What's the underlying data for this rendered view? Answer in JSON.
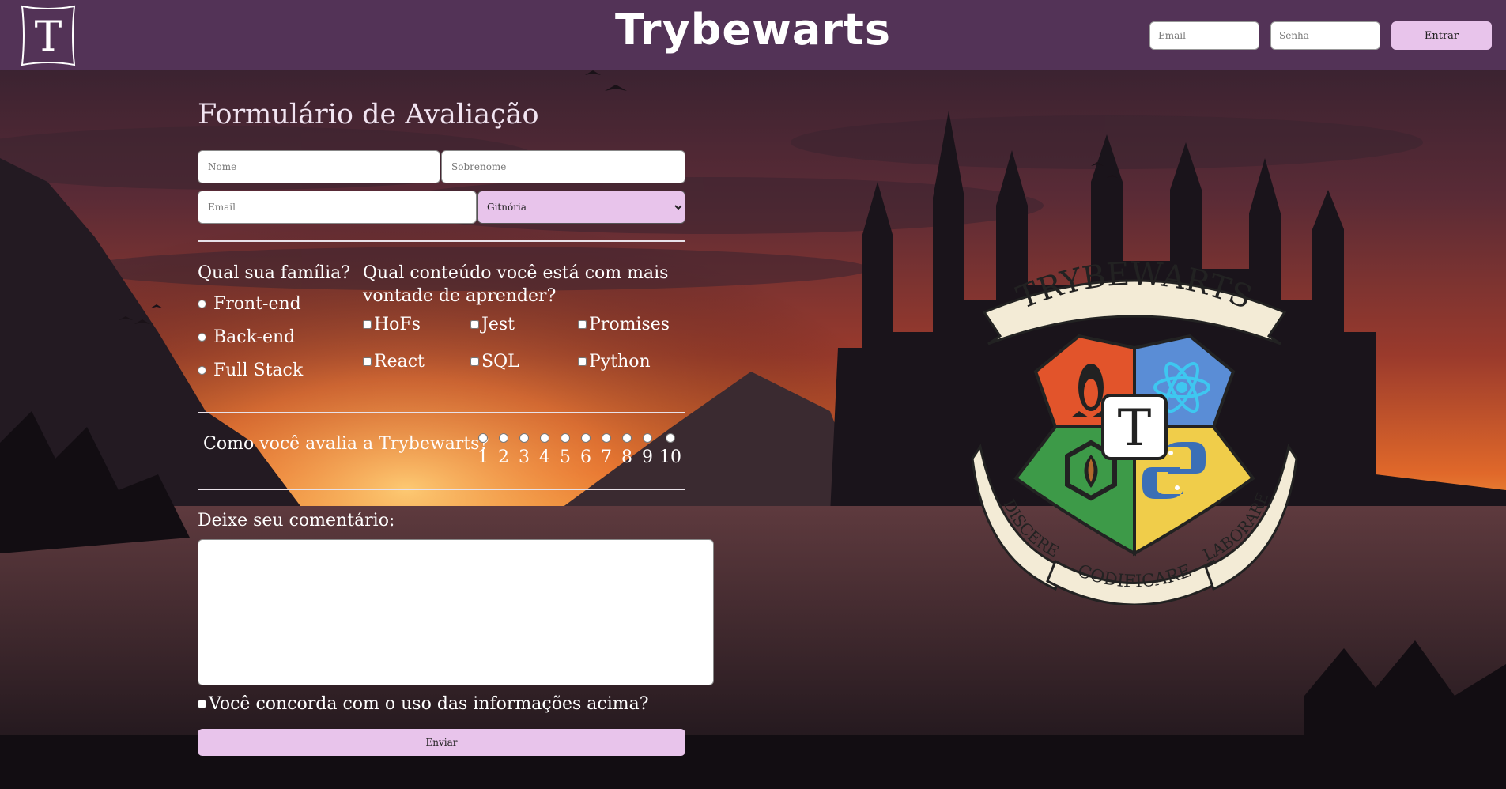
{
  "header": {
    "logo_letter": "T",
    "site_title": "Trybewarts",
    "email_placeholder": "Email",
    "password_placeholder": "Senha",
    "login_label": "Entrar"
  },
  "form": {
    "title": "Formulário de Avaliação",
    "name_placeholder": "Nome",
    "lastname_placeholder": "Sobrenome",
    "email_placeholder": "Email",
    "house_selected": "Gitnória",
    "family_question": "Qual sua família?",
    "family_options": [
      "Front-end",
      "Back-end",
      "Full Stack"
    ],
    "content_question_line1": "Qual conteúdo você está com mais",
    "content_question_line2": "vontade de aprender?",
    "content_options": [
      "HoFs",
      "Jest",
      "Promises",
      "React",
      "SQL",
      "Python"
    ],
    "rating_question": "Como você avalia a Trybewarts?",
    "rating_options": [
      "1",
      "2",
      "3",
      "4",
      "5",
      "6",
      "7",
      "8",
      "9",
      "10"
    ],
    "comment_label": "Deixe seu comentário:",
    "agreement_label": "Você concorda com o uso das informações acima?",
    "submit_label": "Enviar"
  },
  "crest": {
    "banner_text": "TRYBEWARTS",
    "center_letter": "T",
    "motto_left": "DISCERE",
    "motto_middle": "CODIFICARE",
    "motto_right": "LABORARE"
  },
  "colors": {
    "header_bg": "#533357",
    "accent_button": "#e8c4eb",
    "crest_red": "#e2542b",
    "crest_blue": "#5a8dd6",
    "crest_green": "#3d9a48",
    "crest_yellow": "#f0cd4a"
  }
}
